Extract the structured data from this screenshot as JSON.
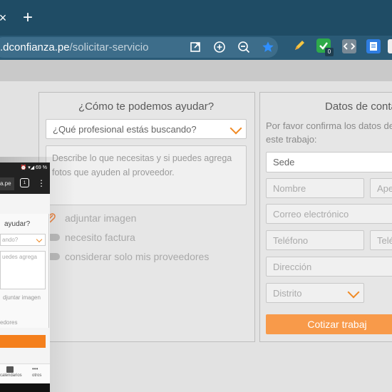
{
  "browser": {
    "tab_close": "×",
    "new_tab": "+",
    "url_host": ".dconfianza.pe",
    "url_path": "/solicitar-servicio",
    "ext_badge": "0"
  },
  "left_card": {
    "title": "¿Cómo te podemos ayudar?",
    "professional_select": "¿Qué profesional estás buscando?",
    "description_placeholder": "Describe lo que necesitas y si puedes agrega fotos que ayuden al proveedor.",
    "attach_label": "adjuntar imagen",
    "invoice_label": "necesito factura",
    "providers_label": "considerar solo mis proveedores"
  },
  "right_card": {
    "title": "Datos de conta",
    "instructions": "Por favor confirma los datos de este trabajo:",
    "sede_label": "Sede",
    "nombre_placeholder": "Nombre",
    "apellido_placeholder": "Apel",
    "correo_placeholder": "Correo electrónico",
    "telefono_placeholder": "Teléfono",
    "telefono2_placeholder": "Telé",
    "direccion_placeholder": "Dirección",
    "distrito_label": "Distrito",
    "submit_label": "Cotizar trabaj"
  },
  "phone": {
    "status_text": "⏰ ▾◢ 69 %",
    "url": "a.pe",
    "tabs_count": "1",
    "menu": "⋮",
    "title": "ayudar?",
    "select_text": "ando?",
    "textarea_text": "uedes agrega",
    "attach_text": "djuntar imagen",
    "providers_text": "edores",
    "nav_calendar": "calendarios",
    "nav_others": "otros"
  }
}
